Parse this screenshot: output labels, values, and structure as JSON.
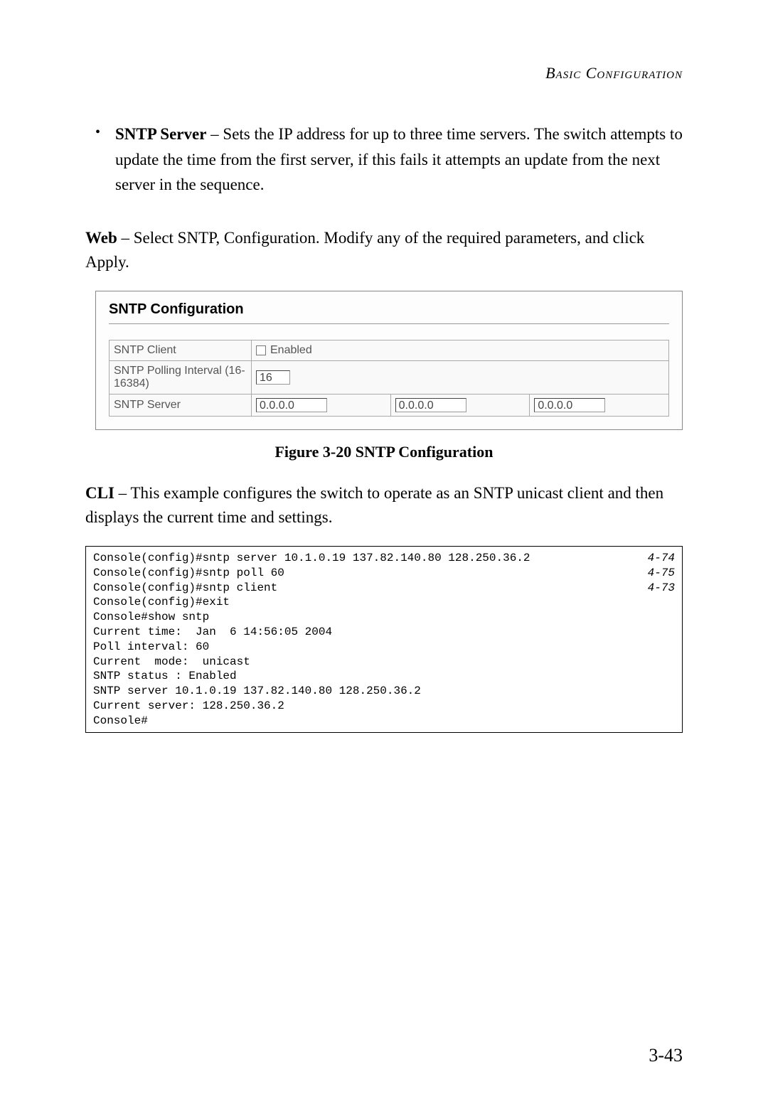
{
  "header": {
    "title": "Basic Configuration"
  },
  "bullet": {
    "marker": "•",
    "term": "SNTP Server",
    "sep": " – ",
    "text": "Sets the IP address for up to three time servers. The switch attempts to update the time from the first server, if this fails it attempts an update from the next server in the sequence."
  },
  "web_para": {
    "lead": "Web",
    "sep": " – ",
    "text": "Select SNTP, Configuration. Modify any of the required parameters, and click Apply."
  },
  "figure": {
    "title": "SNTP Configuration",
    "rows": {
      "client_label": "SNTP Client",
      "enabled_label": "Enabled",
      "poll_label": "SNTP Polling Interval (16-16384)",
      "poll_value": "16",
      "server_label": "SNTP Server",
      "server1": "0.0.0.0",
      "server2": "0.0.0.0",
      "server3": "0.0.0.0"
    }
  },
  "caption": "Figure 3-20  SNTP Configuration",
  "cli_para": {
    "lead": "CLI",
    "sep": " – ",
    "text": "This example configures the switch to operate as an SNTP unicast client and then displays the current time and settings."
  },
  "cli": {
    "lines": [
      {
        "text": "Console(config)#sntp server 10.1.0.19 137.82.140.80 128.250.36.2",
        "ref": "4-74"
      },
      {
        "text": "Console(config)#sntp poll 60",
        "ref": "4-75"
      },
      {
        "text": "Console(config)#sntp client",
        "ref": "4-73"
      },
      {
        "text": "Console(config)#exit",
        "ref": ""
      },
      {
        "text": "Console#show sntp",
        "ref": ""
      },
      {
        "text": "Current time:  Jan  6 14:56:05 2004",
        "ref": ""
      },
      {
        "text": "Poll interval: 60",
        "ref": ""
      },
      {
        "text": "Current  mode:  unicast",
        "ref": ""
      },
      {
        "text": "SNTP status : Enabled",
        "ref": ""
      },
      {
        "text": "SNTP server 10.1.0.19 137.82.140.80 128.250.36.2",
        "ref": ""
      },
      {
        "text": "Current server: 128.250.36.2",
        "ref": ""
      },
      {
        "text": "Console#",
        "ref": ""
      }
    ]
  },
  "page_number": "3-43"
}
